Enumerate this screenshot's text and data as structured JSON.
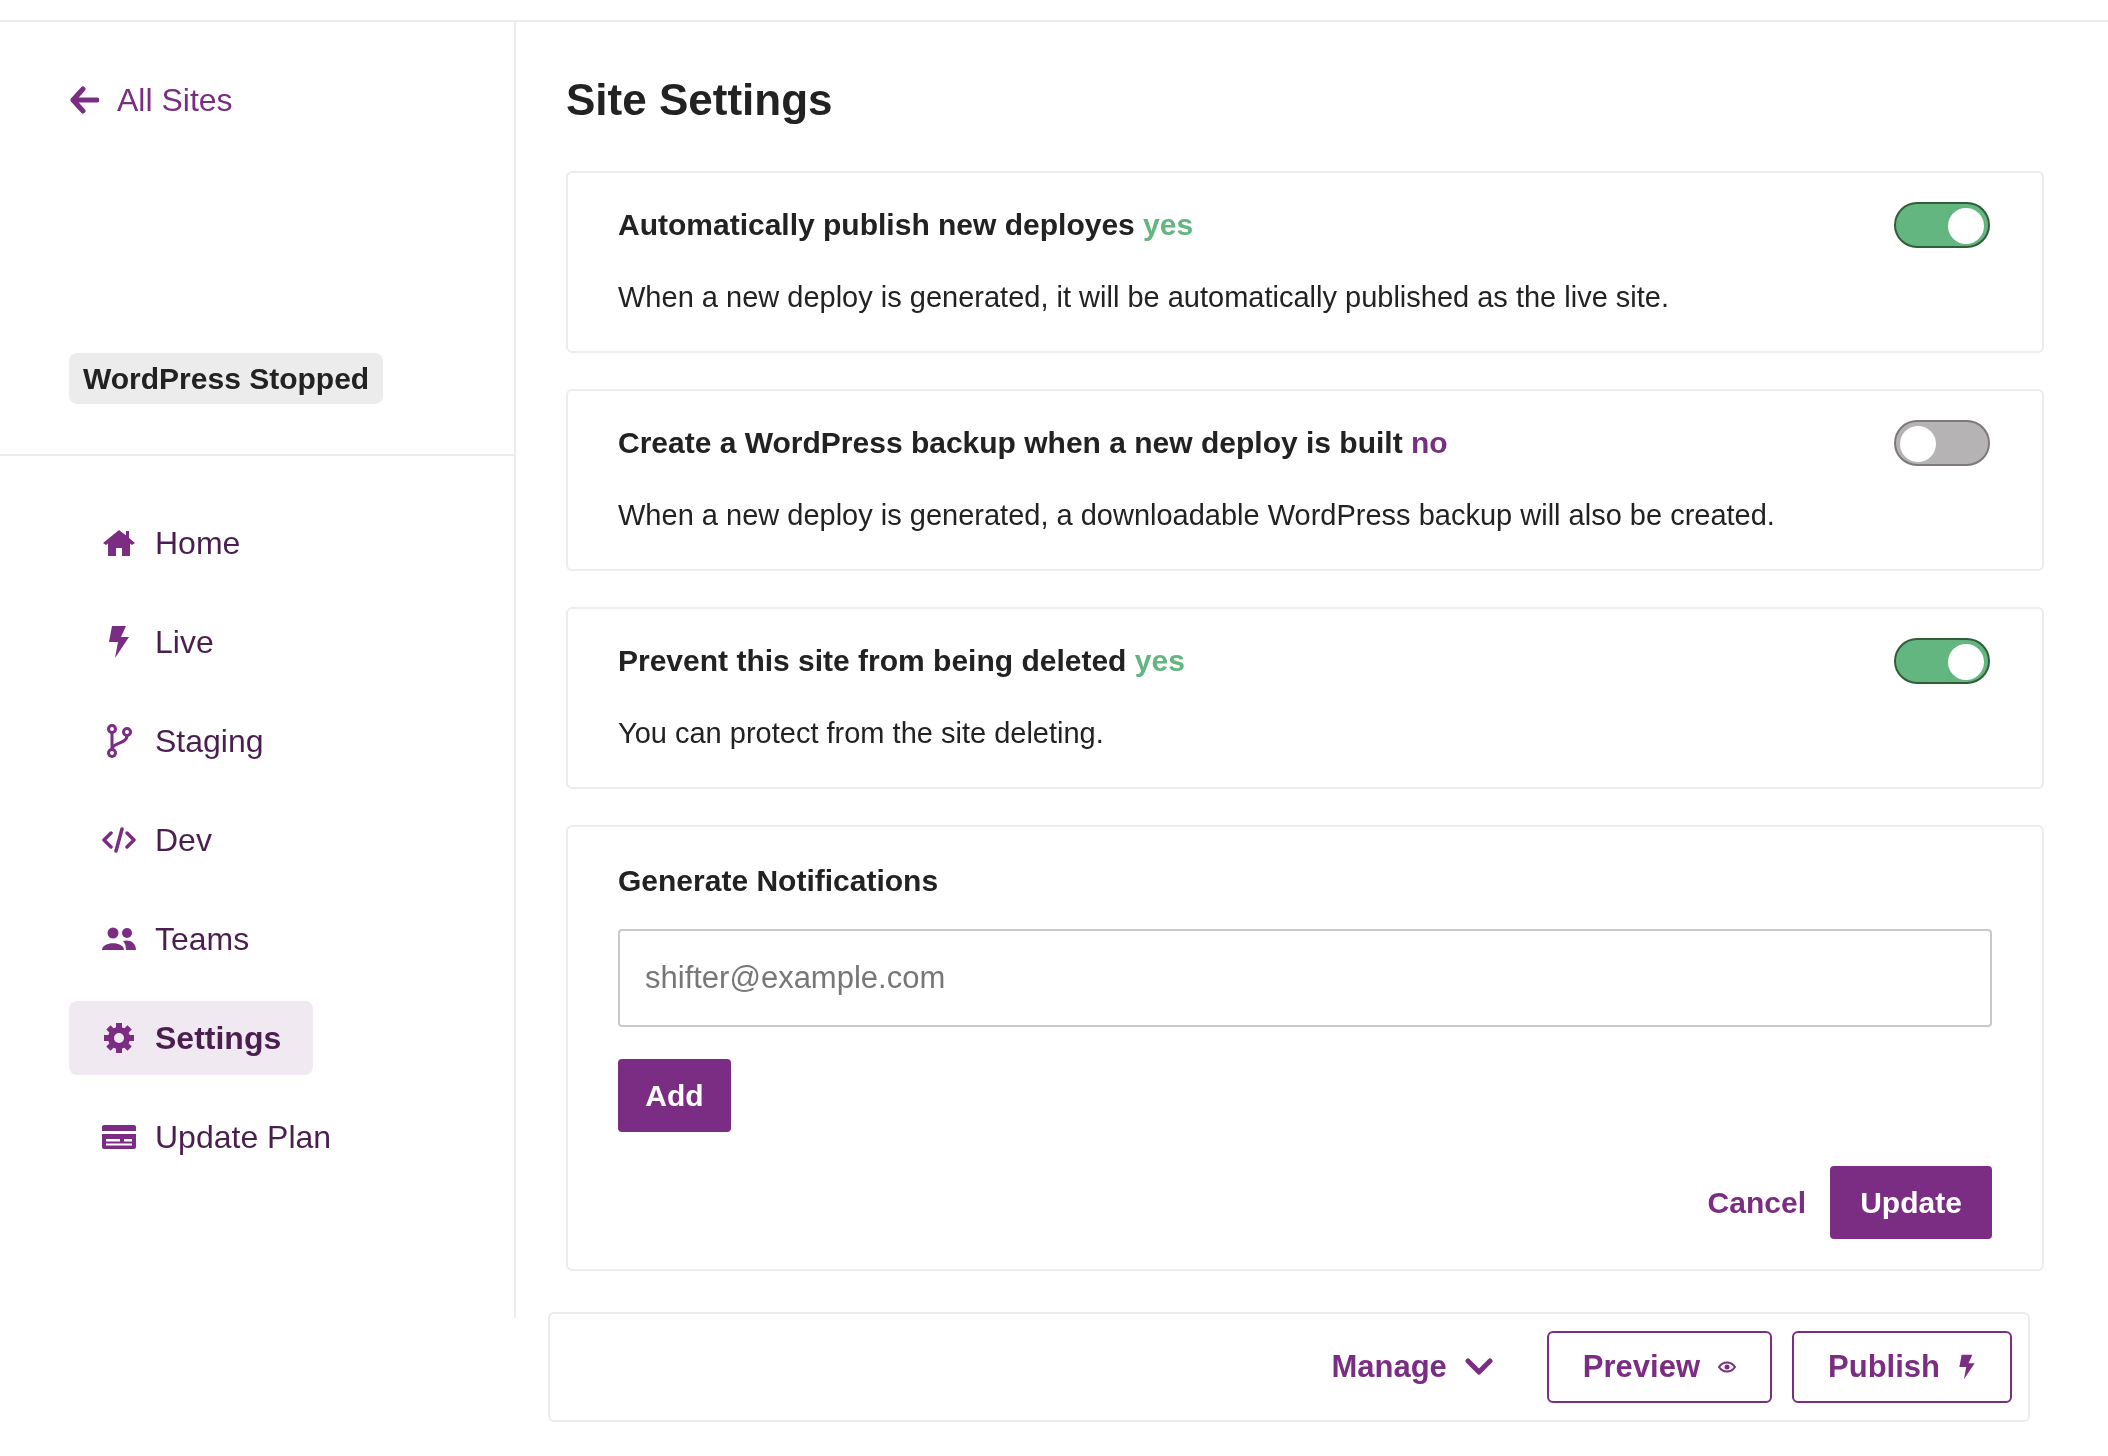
{
  "sidebar": {
    "back_link": "All Sites",
    "status_badge": "WordPress Stopped",
    "nav": [
      {
        "label": "Home",
        "selected": false
      },
      {
        "label": "Live",
        "selected": false
      },
      {
        "label": "Staging",
        "selected": false
      },
      {
        "label": "Dev",
        "selected": false
      },
      {
        "label": "Teams",
        "selected": false
      },
      {
        "label": "Settings",
        "selected": true
      },
      {
        "label": "Update Plan",
        "selected": false
      }
    ]
  },
  "main": {
    "title": "Site Settings",
    "settings": [
      {
        "title": "Automatically publish new deployes",
        "status": "yes",
        "on": true,
        "description": "When a new deploy is generated, it will be automatically published as the live site."
      },
      {
        "title": "Create a WordPress backup when a new deploy is built",
        "status": "no",
        "on": false,
        "description": "When a new deploy is generated, a downloadable WordPress backup will also be created."
      },
      {
        "title": "Prevent this site from being deleted",
        "status": "yes",
        "on": true,
        "description": "You can protect from the site deleting."
      }
    ],
    "notifications": {
      "title": "Generate Notifications",
      "email_field": {
        "placeholder": "shifter@example.com"
      },
      "add_button": "Add",
      "cancel_button": "Cancel",
      "update_button": "Update"
    }
  },
  "action_bar": {
    "manage": "Manage",
    "preview": "Preview",
    "publish": "Publish"
  }
}
